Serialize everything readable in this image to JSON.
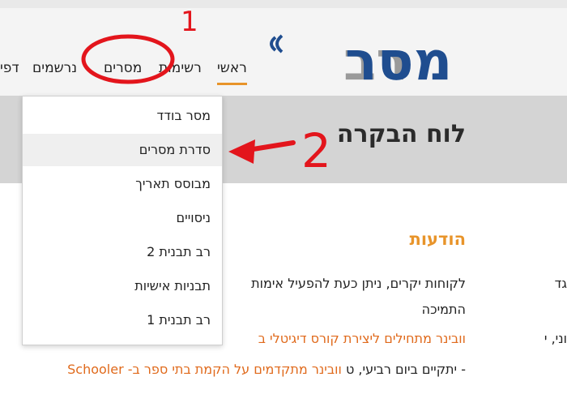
{
  "logo": {
    "text": "רבמסר"
  },
  "nav": {
    "items": [
      {
        "label": "ראשי",
        "active": true
      },
      {
        "label": "רשימות"
      },
      {
        "label": "מסרים"
      },
      {
        "label": "נרשמים"
      },
      {
        "label": "דפי"
      }
    ]
  },
  "dropdown": {
    "items": [
      {
        "label": "מסר בודד"
      },
      {
        "label": "סדרת מסרים",
        "hover": true
      },
      {
        "label": "מבוסס תאריך"
      },
      {
        "label": "ניסויים"
      },
      {
        "label": "רב תבנית 2"
      },
      {
        "label": "תבניות אישיות"
      },
      {
        "label": "רב תבנית 1"
      }
    ]
  },
  "page": {
    "title": "לוח הבקרה"
  },
  "content": {
    "title": "הודעות",
    "line1": "לקוחות יקרים, ניתן כעת להפעיל אימות",
    "line1_extra": "גד",
    "line2": "התמיכה",
    "line3": "וובינר מתחילים ליצירת קורס דיגיטלי ב",
    "line3_extra": "וני, י",
    "line4_a": "וובינר מתקדמים על הקמת בתי ספר ב- Schooler",
    "line4_b": "- יתקיים ביום רביעי, ט"
  },
  "annotations": {
    "num1": "1",
    "num2": "2"
  },
  "colors": {
    "accent": "#e8942a",
    "brand_blue": "#1f4d8f",
    "brand_gray": "#9a9a9a",
    "annotation_red": "#e3151c"
  }
}
